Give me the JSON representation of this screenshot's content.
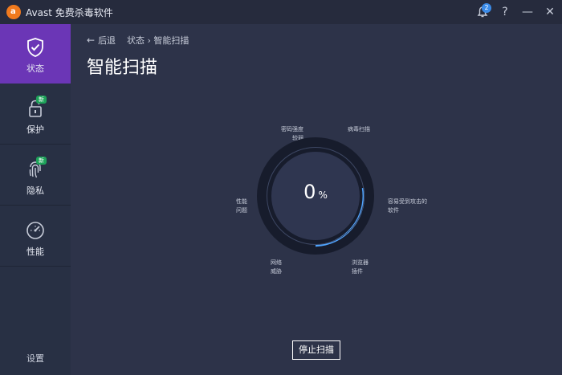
{
  "window": {
    "title": "Avast 免费杀毒软件",
    "logo_icon": "avast-logo-icon",
    "notification_count": "2",
    "help_label": "?",
    "minimize_label": "—",
    "close_label": "✕"
  },
  "sidebar": {
    "items": [
      {
        "label": "状态",
        "icon": "shield-check-icon",
        "active": true
      },
      {
        "label": "保护",
        "icon": "lock-icon",
        "badge": "新"
      },
      {
        "label": "隐私",
        "icon": "fingerprint-icon",
        "badge": "新"
      },
      {
        "label": "性能",
        "icon": "gauge-icon"
      }
    ],
    "settings_label": "设置"
  },
  "main": {
    "back_label": "后退",
    "breadcrumb": {
      "state": "状态",
      "separator": "›",
      "current": "智能扫描"
    },
    "page_title": "智能扫描",
    "progress_value": "0",
    "progress_unit": "%",
    "scan_items": [
      {
        "line1": "密码强度",
        "line2": "较弱"
      },
      {
        "line1": "病毒扫描",
        "line2": ""
      },
      {
        "line1": "容易受到攻击的",
        "line2": "软件"
      },
      {
        "line1": "性能",
        "line2": "问题"
      },
      {
        "line1": "网络",
        "line2": "威胁"
      },
      {
        "line1": "浏览器",
        "line2": "插件"
      }
    ],
    "stop_button_label": "停止扫描"
  },
  "colors": {
    "title_bar": "#262b3d",
    "sidebar": "#283044",
    "active": "#6b36b6",
    "main": "#2d3349",
    "progress": "#4ea4ff",
    "badge_green": "#1ea35a"
  }
}
